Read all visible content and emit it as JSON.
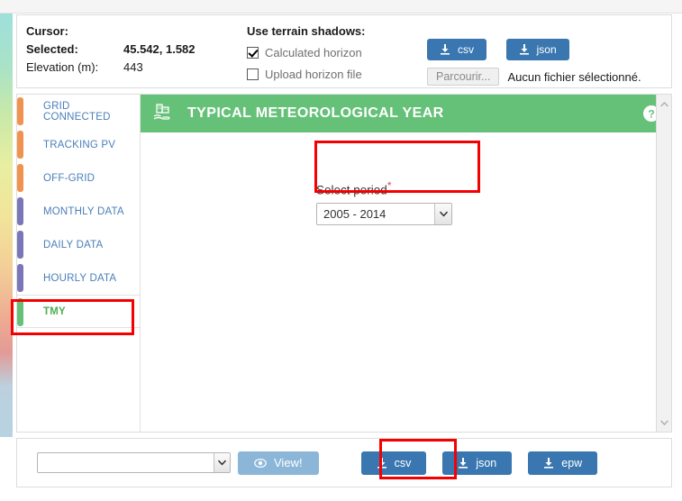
{
  "info_panel": {
    "cursor_label": "Cursor:",
    "selected_label": "Selected:",
    "selected_value": "45.542, 1.582",
    "elevation_label": "Elevation (m):",
    "elevation_value": "443",
    "terrain_title": "Use terrain shadows:",
    "checkbox_calculated": "Calculated horizon",
    "checkbox_upload": "Upload horizon file",
    "download_csv": "csv",
    "download_json": "json",
    "browse_button": "Parcourir...",
    "file_status": "Aucun fichier sélectionné."
  },
  "sidebar": {
    "items": [
      {
        "label": "GRID CONNECTED",
        "color": "#f0934e",
        "active": false
      },
      {
        "label": "TRACKING PV",
        "color": "#f0934e",
        "active": false
      },
      {
        "label": "OFF-GRID",
        "color": "#f0934e",
        "active": false
      },
      {
        "label": "MONTHLY DATA",
        "color": "#7b76b8",
        "active": false
      },
      {
        "label": "DAILY DATA",
        "color": "#7b76b8",
        "active": false
      },
      {
        "label": "HOURLY DATA",
        "color": "#7b76b8",
        "active": false
      },
      {
        "label": "TMY",
        "color": "#65c178",
        "active": true
      }
    ]
  },
  "panel": {
    "title": "TYPICAL METEOROLOGICAL YEAR",
    "header_color": "#65c178",
    "icon": "hand-building-icon",
    "help_icon": "help-circle-icon",
    "select_period_label": "Select period",
    "required_marker": "*",
    "select_period_value": "2005 - 2014"
  },
  "bottom_bar": {
    "format_select_value": "",
    "view_button": "View!",
    "download_csv": "csv",
    "download_json": "json",
    "download_epw": "epw"
  },
  "colors": {
    "blue_button": "#3a77b0",
    "blue_button_light": "#8bb6d8",
    "green_header": "#65c178",
    "annotation_red": "#f40000",
    "link_blue": "#4a7fba",
    "active_green": "#4caf50"
  }
}
